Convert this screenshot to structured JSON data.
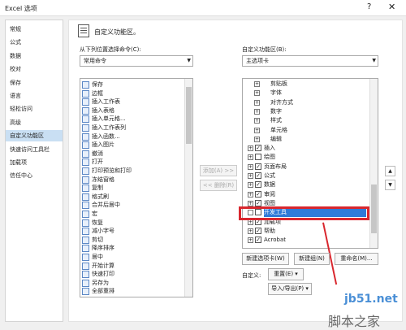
{
  "window": {
    "title": "Excel 选项",
    "help": "?",
    "close": "✕"
  },
  "sidebar": {
    "items": [
      "常规",
      "公式",
      "数据",
      "校对",
      "保存",
      "语言",
      "轻松访问",
      "高级",
      "自定义功能区",
      "快速访问工具栏",
      "加载项",
      "信任中心"
    ],
    "selected": 8
  },
  "header": {
    "title": "自定义功能区。"
  },
  "left": {
    "label": "从下列位置选择命令(C):",
    "combo_value": "常用命令",
    "commands": [
      "保存",
      "边框",
      "插入工作表",
      "插入表格",
      "插入单元格...",
      "插入工作表列",
      "插入函数...",
      "插入图片",
      "撤消",
      "打开",
      "打印预览和打印",
      "冻结窗格",
      "复制",
      "格式刷",
      "合并后居中",
      "宏",
      "恢复",
      "减小字号",
      "剪切",
      "降序排序",
      "居中",
      "开始计算",
      "快速打印",
      "另存为",
      "全部重排"
    ]
  },
  "middle": {
    "add_label": "添加(A) >>",
    "remove_label": "<< 删除(R)"
  },
  "right": {
    "label": "自定义功能区(B):",
    "combo_value": "主选项卡",
    "tree": [
      {
        "text": "剪贴板",
        "level": 2,
        "exp": "+",
        "cb": false
      },
      {
        "text": "字体",
        "level": 2,
        "exp": "+",
        "cb": false
      },
      {
        "text": "对齐方式",
        "level": 2,
        "exp": "+",
        "cb": false
      },
      {
        "text": "数字",
        "level": 2,
        "exp": "+",
        "cb": false
      },
      {
        "text": "样式",
        "level": 2,
        "exp": "+",
        "cb": false
      },
      {
        "text": "单元格",
        "level": 2,
        "exp": "+",
        "cb": false
      },
      {
        "text": "编辑",
        "level": 2,
        "exp": "+",
        "cb": false
      },
      {
        "text": "插入",
        "level": 1,
        "exp": "+",
        "cb": true
      },
      {
        "text": "绘图",
        "level": 1,
        "exp": "+",
        "cb": false
      },
      {
        "text": "页面布局",
        "level": 1,
        "exp": "+",
        "cb": true
      },
      {
        "text": "公式",
        "level": 1,
        "exp": "+",
        "cb": true
      },
      {
        "text": "数据",
        "level": 1,
        "exp": "+",
        "cb": true
      },
      {
        "text": "审阅",
        "level": 1,
        "exp": "+",
        "cb": true
      },
      {
        "text": "视图",
        "level": 1,
        "exp": "+",
        "cb": true
      },
      {
        "text": "开发工具",
        "level": 1,
        "exp": "+",
        "cb": true,
        "hl": true
      },
      {
        "text": "加载项",
        "level": 1,
        "exp": "+",
        "cb": true
      },
      {
        "text": "帮助",
        "level": 1,
        "exp": "+",
        "cb": true
      },
      {
        "text": "Acrobat",
        "level": 1,
        "exp": "+",
        "cb": true
      }
    ],
    "new_tab": "新建选项卡(W)",
    "new_group": "新建组(N)",
    "rename": "重命名(M)...",
    "custom_label": "自定义:",
    "reset": "重置(E) ▾",
    "import_export": "导入/导出(P) ▾"
  },
  "watermark": {
    "site": "jb51.net",
    "name": "脚本之家"
  },
  "colors": {
    "highlight": "#2f7bd8",
    "annotation": "#d9272e",
    "selected_nav": "#c9dff3"
  }
}
